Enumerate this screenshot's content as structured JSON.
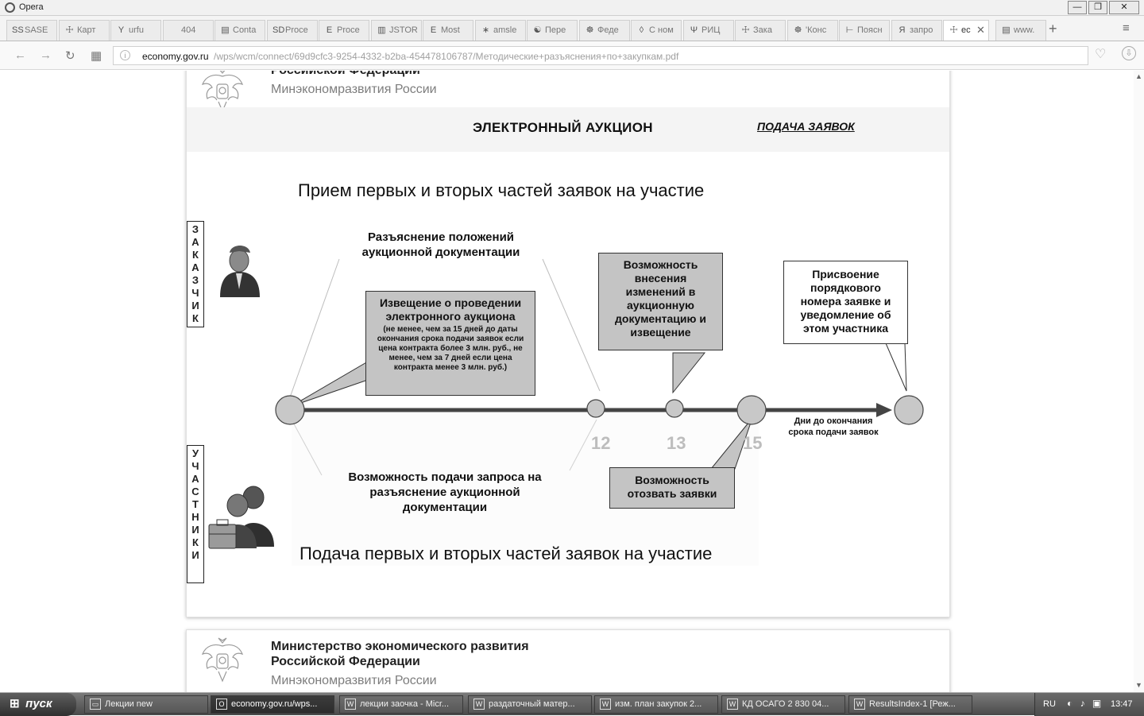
{
  "window": {
    "app_name": "Opera",
    "minimize": "—",
    "maximize": "❐",
    "close": "✕"
  },
  "tabs": [
    {
      "icon": "SS",
      "label": "SASE"
    },
    {
      "icon": "☩",
      "label": "Карт"
    },
    {
      "icon": "Y",
      "label": "urfu"
    },
    {
      "icon": "",
      "label": "404"
    },
    {
      "icon": "▤",
      "label": "Conta"
    },
    {
      "icon": "SD",
      "label": "Proce"
    },
    {
      "icon": "E",
      "label": "Proce"
    },
    {
      "icon": "▥",
      "label": "JSTOR"
    },
    {
      "icon": "E",
      "label": "Most"
    },
    {
      "icon": "∗",
      "label": "amsle"
    },
    {
      "icon": "☯",
      "label": "Пере"
    },
    {
      "icon": "☸",
      "label": "Феде"
    },
    {
      "icon": "◊",
      "label": "С ном"
    },
    {
      "icon": "Ψ",
      "label": "РИЦ"
    },
    {
      "icon": "☩",
      "label": "Зака"
    },
    {
      "icon": "☸",
      "label": "'Конс"
    },
    {
      "icon": "⊢",
      "label": "Поясн"
    },
    {
      "icon": "Я",
      "label": "запро"
    },
    {
      "icon": "☩",
      "label": "ec"
    },
    {
      "icon": "▤",
      "label": "www."
    }
  ],
  "toolbar": {
    "back": "←",
    "forward": "→",
    "reload": "↻",
    "speed_dial": "▦",
    "new_tab": "+",
    "tab_menu": "≡",
    "heart": "♡",
    "download": "⇩"
  },
  "address": {
    "domain": "economy.gov.ru",
    "path": "/wps/wcm/connect/69d9cfc3-9254-4332-b2ba-454478106787/Методические+разъяснения+по+закупкам.pdf"
  },
  "scroll": {
    "up": "▲",
    "down": "▼"
  },
  "page1": {
    "org_name": "Российской Федерации",
    "org_sub": "Минэкономразвития России",
    "title": "ЭЛЕКТРОННЫЙ АУКЦИОН",
    "section": "ПОДАЧА ЗАЯВОК",
    "top_heading": "Прием первых и вторых частей заявок на участие",
    "bottom_heading": "Подача первых и вторых частей заявок на участие",
    "label_customer": [
      "З",
      "А",
      "К",
      "А",
      "З",
      "Ч",
      "И",
      "К"
    ],
    "label_participants": [
      "У",
      "Ч",
      "А",
      "С",
      "Т",
      "Н",
      "И",
      "К",
      "И"
    ],
    "clarification": "Разъяснение положений аукционной документации",
    "notice_title": "Извещение о проведении электронного аукциона",
    "notice_note": "(не менее, чем за 15 дней до даты окончания срока подачи заявок если цена контракта более 3 млн. руб., не менее, чем за 7 дней если цена контракта менее 3 млн. руб.)",
    "changes_box": "Возможность внесения изменений в аукционную документацию и извещение",
    "assign_box": "Присвоение порядкового номера заявке и уведомление об этом участника",
    "request_text": "Возможность подачи запроса на разъяснение аукционной документации",
    "withdraw_box": "Возможность отозвать заявки",
    "tick_12": "12",
    "tick_13": "13",
    "tick_15": "15",
    "axis_label": "Дни до окончания срока подачи заявок"
  },
  "page2": {
    "org_line1": "Министерство экономического развития",
    "org_line2": "Российской Федерации",
    "org_sub": "Минэкономразвития России"
  },
  "taskbar": {
    "start": "пуск",
    "tasks": [
      {
        "icon": "▭",
        "label": "Лекции new"
      },
      {
        "icon": "O",
        "label": "economy.gov.ru/wps..."
      },
      {
        "icon": "W",
        "label": "лекции заочка - Micr..."
      },
      {
        "icon": "W",
        "label": "раздаточный матер..."
      },
      {
        "icon": "W",
        "label": "изм. план закупок 2..."
      },
      {
        "icon": "W",
        "label": "КД ОСАГО 2 830 04..."
      },
      {
        "icon": "W",
        "label": "ResultsIndex-1 [Реж..."
      }
    ],
    "lang": "RU",
    "tray_icons": "◐ ♪ ▣",
    "clock": "13:47"
  }
}
